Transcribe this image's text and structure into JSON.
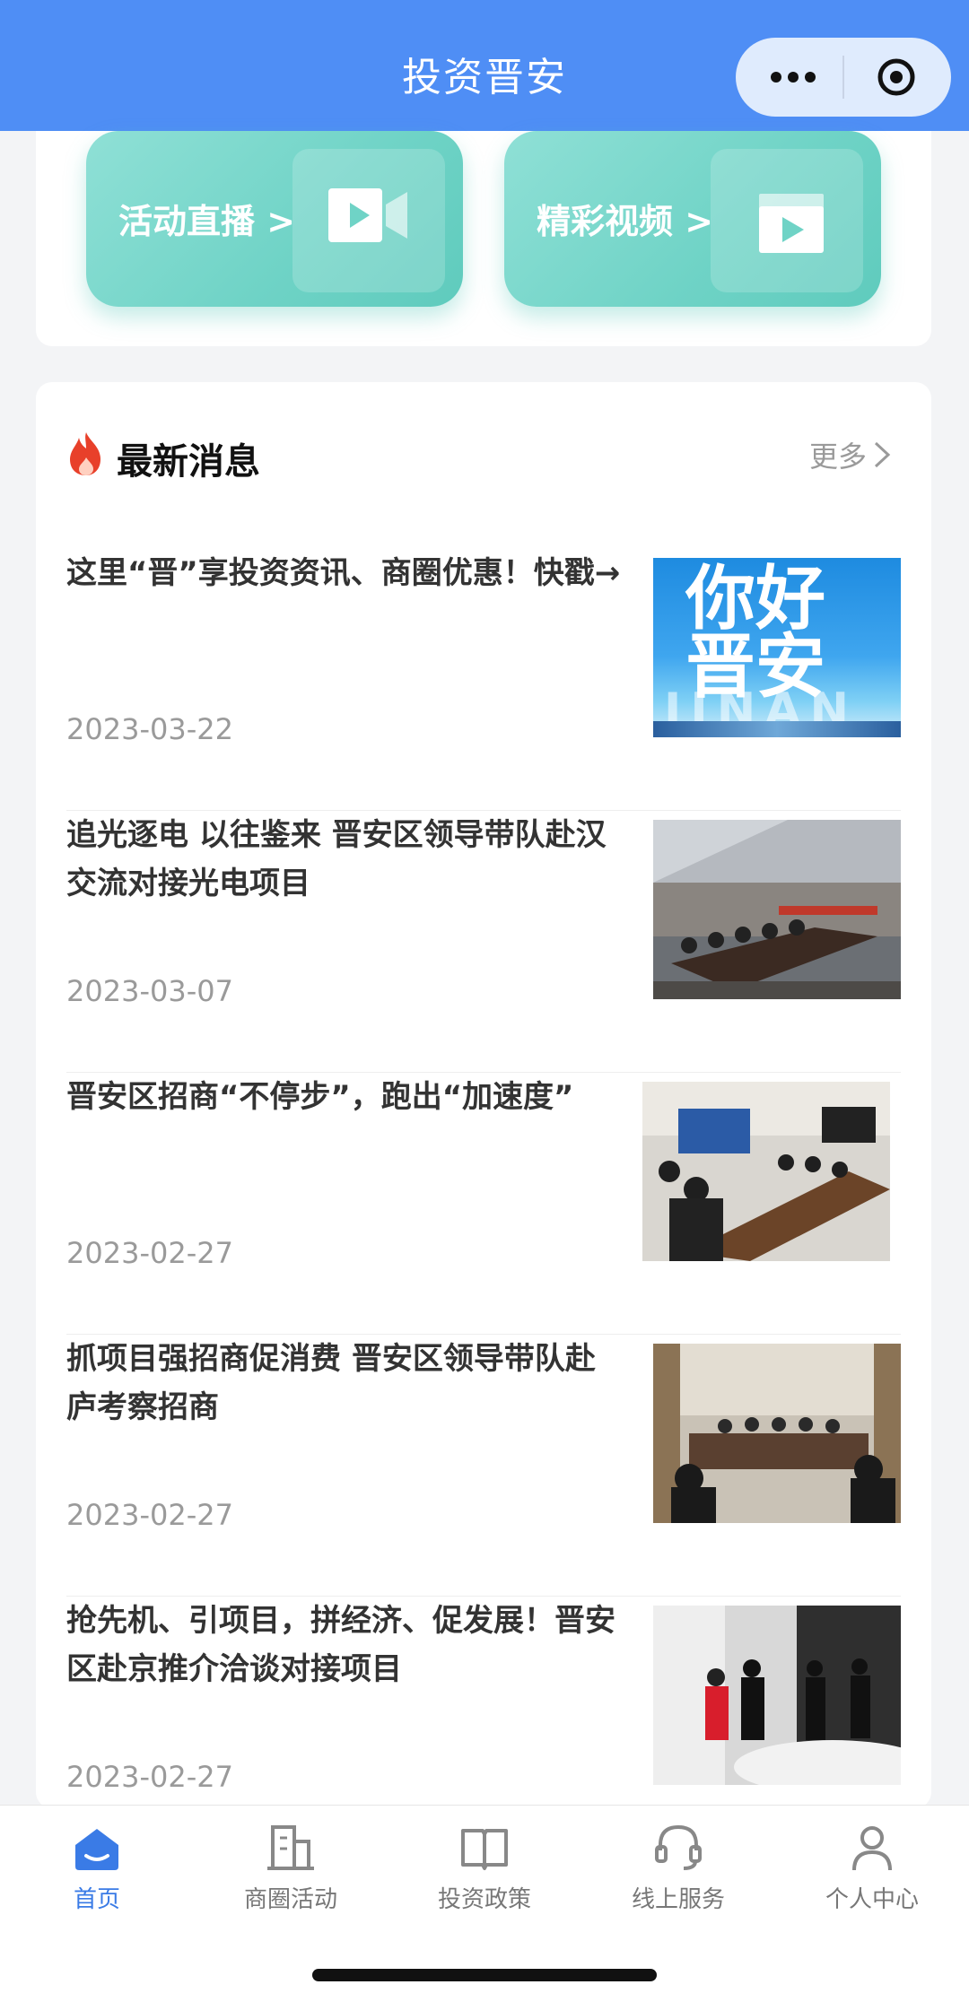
{
  "nav": {
    "title": "投资晋安"
  },
  "media_buttons": [
    {
      "label": "活动直播 >",
      "icon": "video-camera-icon"
    },
    {
      "label": "精彩视频 >",
      "icon": "video-play-icon"
    }
  ],
  "news": {
    "title": "最新消息",
    "more_label": "更多",
    "items": [
      {
        "headline": "这里“晋”享投资资讯、商圈优惠！快戳→",
        "date": "2023-03-22",
        "thumb_text_1": "你好",
        "thumb_text_2": "晋安",
        "thumb_text_3": "JINAN"
      },
      {
        "headline": "追光逐电 以往鉴来 晋安区领导带队赴汉交流对接光电项目",
        "date": "2023-03-07"
      },
      {
        "headline": "晋安区招商“不停步”，跑出“加速度”",
        "date": "2023-02-27"
      },
      {
        "headline": "抓项目强招商促消费 晋安区领导带队赴庐考察招商",
        "date": "2023-02-27"
      },
      {
        "headline": "抢先机、引项目，拼经济、促发展！晋安区赴京推介洽谈对接项目",
        "date": "2023-02-27"
      }
    ]
  },
  "tabs": [
    {
      "label": "首页",
      "icon": "home-icon",
      "active": true
    },
    {
      "label": "商圈活动",
      "icon": "building-icon"
    },
    {
      "label": "投资政策",
      "icon": "book-icon"
    },
    {
      "label": "线上服务",
      "icon": "headset-icon"
    },
    {
      "label": "个人中心",
      "icon": "user-icon"
    }
  ],
  "colors": {
    "nav_bg": "#4f8ef5",
    "accent": "#3a7be6",
    "teal": "#6fd3c6"
  }
}
